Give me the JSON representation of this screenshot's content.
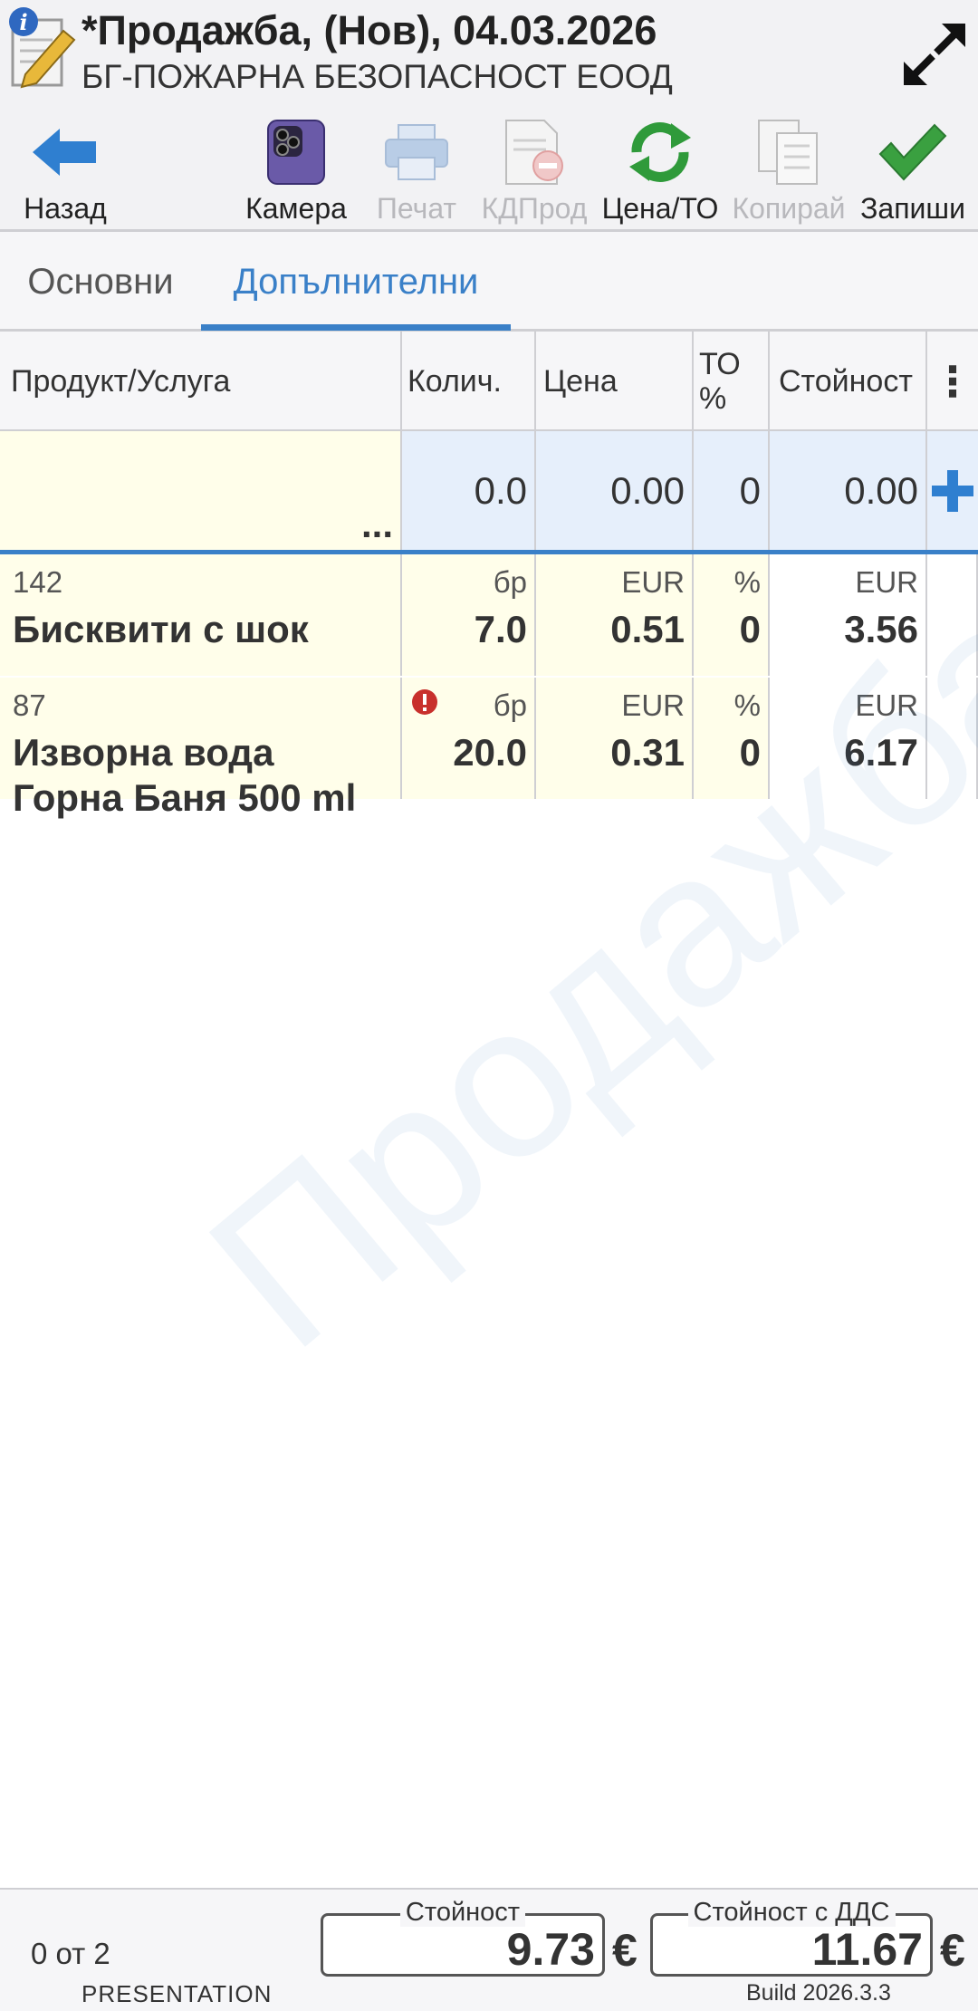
{
  "header": {
    "title": "*Продажба, (Нов), 04.03.2026",
    "subtitle": "БГ-ПОЖАРНА БЕЗОПАСНОСТ ЕООД"
  },
  "toolbar": {
    "back": "Назад",
    "camera": "Камера",
    "print": "Печат",
    "kd_prod": "КДПрод",
    "price_to": "Цена/ТО",
    "copy": "Копирай",
    "save": "Запиши"
  },
  "tabs": {
    "main": "Основни",
    "additional": "Допълнителни"
  },
  "grid": {
    "headers": {
      "product": "Продукт/Услуга",
      "qty": "Колич.",
      "price": "Цена",
      "to_line1": "ТО",
      "to_line2": "%",
      "value": "Стойност",
      "menu": "⋮"
    },
    "new_row": {
      "ellipsis": "...",
      "qty": "0.0",
      "price": "0.00",
      "to": "0",
      "value": "0.00"
    },
    "rows": [
      {
        "code": "142",
        "name_line1": "Бисквити с шок",
        "name_line2": "",
        "unit": "бр",
        "qty": "7.0",
        "currency": "EUR",
        "price": "0.51",
        "to_unit": "%",
        "to": "0",
        "value_currency": "EUR",
        "value": "3.56"
      },
      {
        "code": "87",
        "name_line1": "Изворна вода",
        "name_line2": "Горна Баня 500 ml",
        "unit": "бр",
        "qty": "20.0",
        "currency": "EUR",
        "price": "0.31",
        "to_unit": "%",
        "to": "0",
        "value_currency": "EUR",
        "value": "6.17"
      }
    ]
  },
  "watermark": "Продажба",
  "footer": {
    "counter": "0 от 2",
    "presentation": "PRESENTATION",
    "value_label": "Стойност",
    "value": "9.73",
    "vat_label": "Стойност с ДДС",
    "vat_value": "11.67",
    "currency_symbol": "€",
    "build": "Build 2026.3.3"
  },
  "colors": {
    "accent": "#3a80c8",
    "row_bg": "#fffeea",
    "new_row_bg": "#e6effb",
    "error": "#c8302c"
  }
}
